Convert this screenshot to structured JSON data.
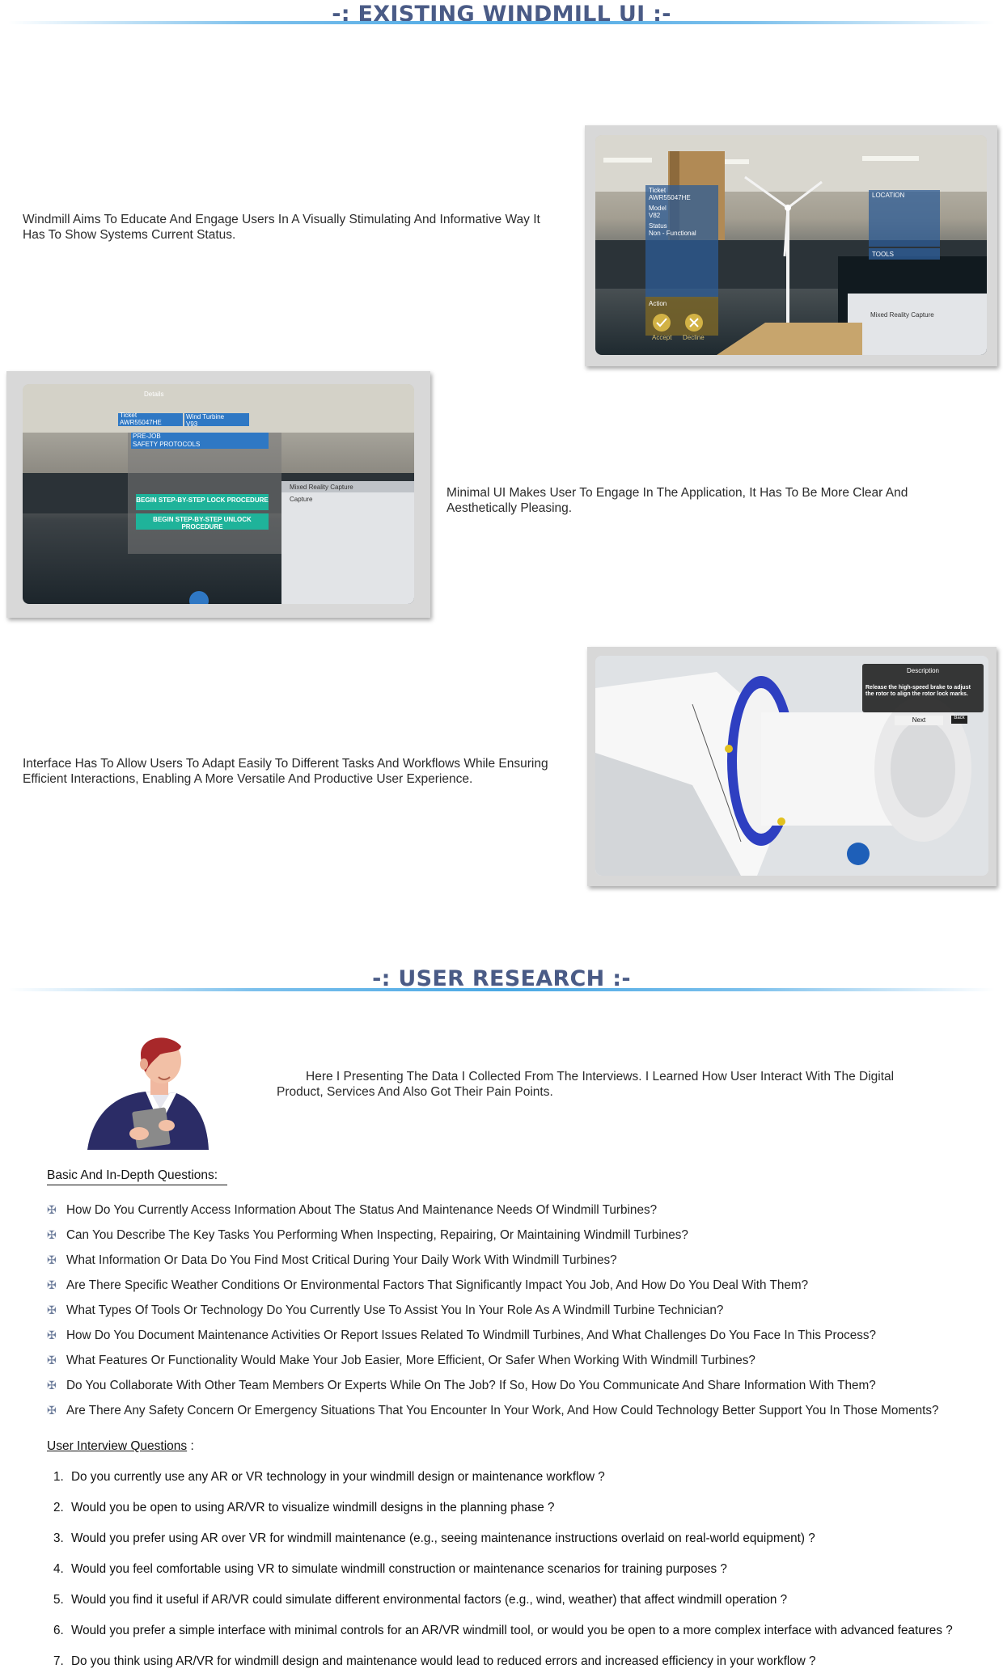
{
  "sections": {
    "existing_title": "-: EXISTING WINDMILL UI :-",
    "research_title": "-: USER RESEARCH :-"
  },
  "existing": {
    "block1": "Windmill Aims To Educate And Engage Users In A Visually Stimulating And Informative Way It Has To Show Systems Current Status.",
    "block2": "Minimal UI Makes User To Engage In The Application, It Has To Be More Clear And Aesthetically Pleasing.",
    "block3": "Interface Has To Allow Users To Adapt Easily To Different Tasks And  Workflows While Ensuring Efficient Interactions, Enabling A More Versatile And Productive User Experience."
  },
  "shot1": {
    "ticket_label": "Ticket",
    "ticket_value": "AWR55047HE",
    "model_label": "Model",
    "model_value": "V82",
    "status_label": "Status",
    "status_value": "Non - Functional",
    "action": "Action",
    "accept": "Accept",
    "decline": "Decline",
    "location": "LOCATION",
    "tools": "TOOLS",
    "mixed": "Mixed Reality Capture"
  },
  "shot2": {
    "details": "Details",
    "ticket_label": "Ticket",
    "ticket_value": "AWR55047HE",
    "turbine_label": "Wind Turbine",
    "turbine_value": "V93",
    "prejob": "PRE-JOB",
    "safety": "SAFETY PROTOCOLS",
    "lock_btn": "BEGIN STEP-BY-STEP LOCK PROCEDURE",
    "unlock_btn": "BEGIN STEP-BY-STEP UNLOCK PROCEDURE",
    "mixed": "Mixed Reality Capture",
    "capture": "Capture"
  },
  "shot3": {
    "desc_title": "Description",
    "desc_text": "Release the high-speed brake to adjust the rotor to align the rotor lock marks.",
    "next": "Next",
    "back": "Back"
  },
  "research": {
    "intro": "Here I Presenting The Data I Collected From The Interviews. I Learned How User Interact With The Digital Product,  Services And Also Got Their Pain Points.",
    "basic_heading": "Basic And In-Depth Questions:",
    "basic_questions": [
      "How Do You Currently Access Information About The Status And Maintenance Needs Of Windmill Turbines?",
      "Can You Describe The Key Tasks You Performing When Inspecting, Repairing, Or Maintaining Windmill Turbines?",
      "What Information Or Data Do You Find Most Critical During Your Daily Work With Windmill Turbines?",
      "Are There Specific Weather Conditions Or Environmental Factors That Significantly Impact You Job, And How Do You Deal With Them?",
      "What Types Of Tools Or Technology Do You Currently Use To Assist You In Your Role As A Windmill Turbine Technician?",
      "How Do You Document Maintenance Activities Or Report Issues Related To Windmill Turbines, And What Challenges Do You Face In This Process?",
      "What Features Or Functionality Would Make Your Job Easier, More Efficient, Or Safer When Working With Windmill Turbines?",
      "Do You Collaborate With Other Team Members Or Experts While On The Job? If So, How Do You Communicate And Share Information With Them?",
      "Are There Any Safety Concern Or Emergency Situations That You Encounter In Your Work, And How Could Technology Better Support You In Those Moments?"
    ],
    "interview_heading": "User Interview Questions",
    "interview_colon": " :",
    "interview_questions": [
      "Do you currently use any AR or VR technology in your windmill design or maintenance workflow ?",
      "Would you be open to using AR/VR to visualize windmill designs in the planning phase ?",
      "Would you prefer using AR over VR for windmill maintenance (e.g., seeing maintenance instructions overlaid on real-world equipment) ?",
      "Would you feel comfortable using VR to simulate windmill construction or maintenance scenarios for training purposes ?",
      "Would you find it useful if AR/VR could simulate different environmental factors (e.g., wind, weather) that affect windmill operation ?",
      "Would you prefer a simple interface with minimal controls for an AR/VR windmill tool, or would you be open to a more complex interface with advanced features ?",
      "Do you think using AR/VR for windmill design and maintenance would lead to reduced errors and increased efficiency in your workflow ?"
    ],
    "numbers": [
      "1.",
      "2.",
      "3.",
      "4.",
      "5.",
      "6.",
      "7."
    ]
  },
  "colors": {
    "title": "#4a5b86",
    "rule": "#4aa8e4",
    "teal_button": "#1fb39a",
    "ar_blue": "#2f78c4"
  }
}
